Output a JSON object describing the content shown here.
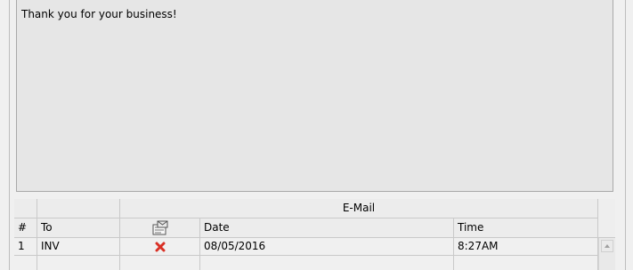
{
  "message": {
    "text": "Thank you for your business!"
  },
  "email_grid": {
    "group_header": "E-Mail",
    "columns": {
      "number": "#",
      "to": "To",
      "attachment_icon": "attachment-icon",
      "date": "Date",
      "time": "Time"
    },
    "rows": [
      {
        "number": "1",
        "to": "INV",
        "status_icon": "red-x-icon",
        "date": "08/05/2016",
        "time": "8:27AM"
      }
    ]
  },
  "colors": {
    "message_bg": "#e6e6e6",
    "grid_bg": "#eeeeee",
    "status_icon": "#d93025"
  }
}
